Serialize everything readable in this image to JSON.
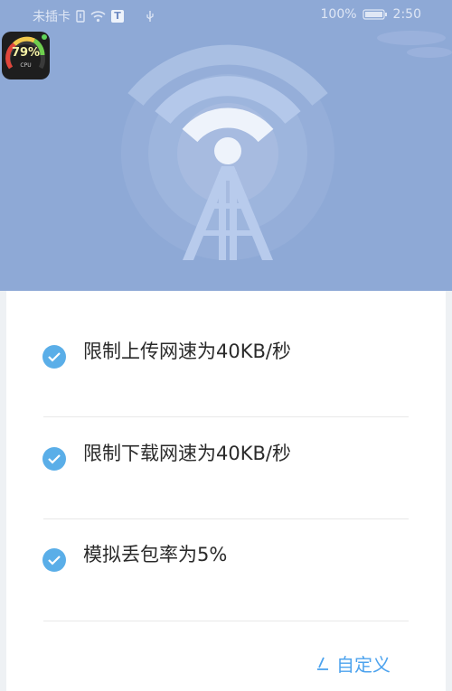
{
  "status_bar": {
    "carrier": "未插卡",
    "sim_badge": "T",
    "battery": "100%",
    "time": "2:50"
  },
  "cpu_widget": {
    "percent": "79%",
    "label": "CPU"
  },
  "options": [
    {
      "label": "限制上传网速为40KB/秒",
      "checked": true
    },
    {
      "label": "限制下载网速为40KB/秒",
      "checked": true
    },
    {
      "label": "模拟丢包率为5%",
      "checked": true
    }
  ],
  "custom": {
    "label": "自定义",
    "icon": "pencil-icon"
  },
  "colors": {
    "header_bg": "#8ea9d6",
    "accent": "#4da3ee",
    "check": "#5aaee8"
  }
}
